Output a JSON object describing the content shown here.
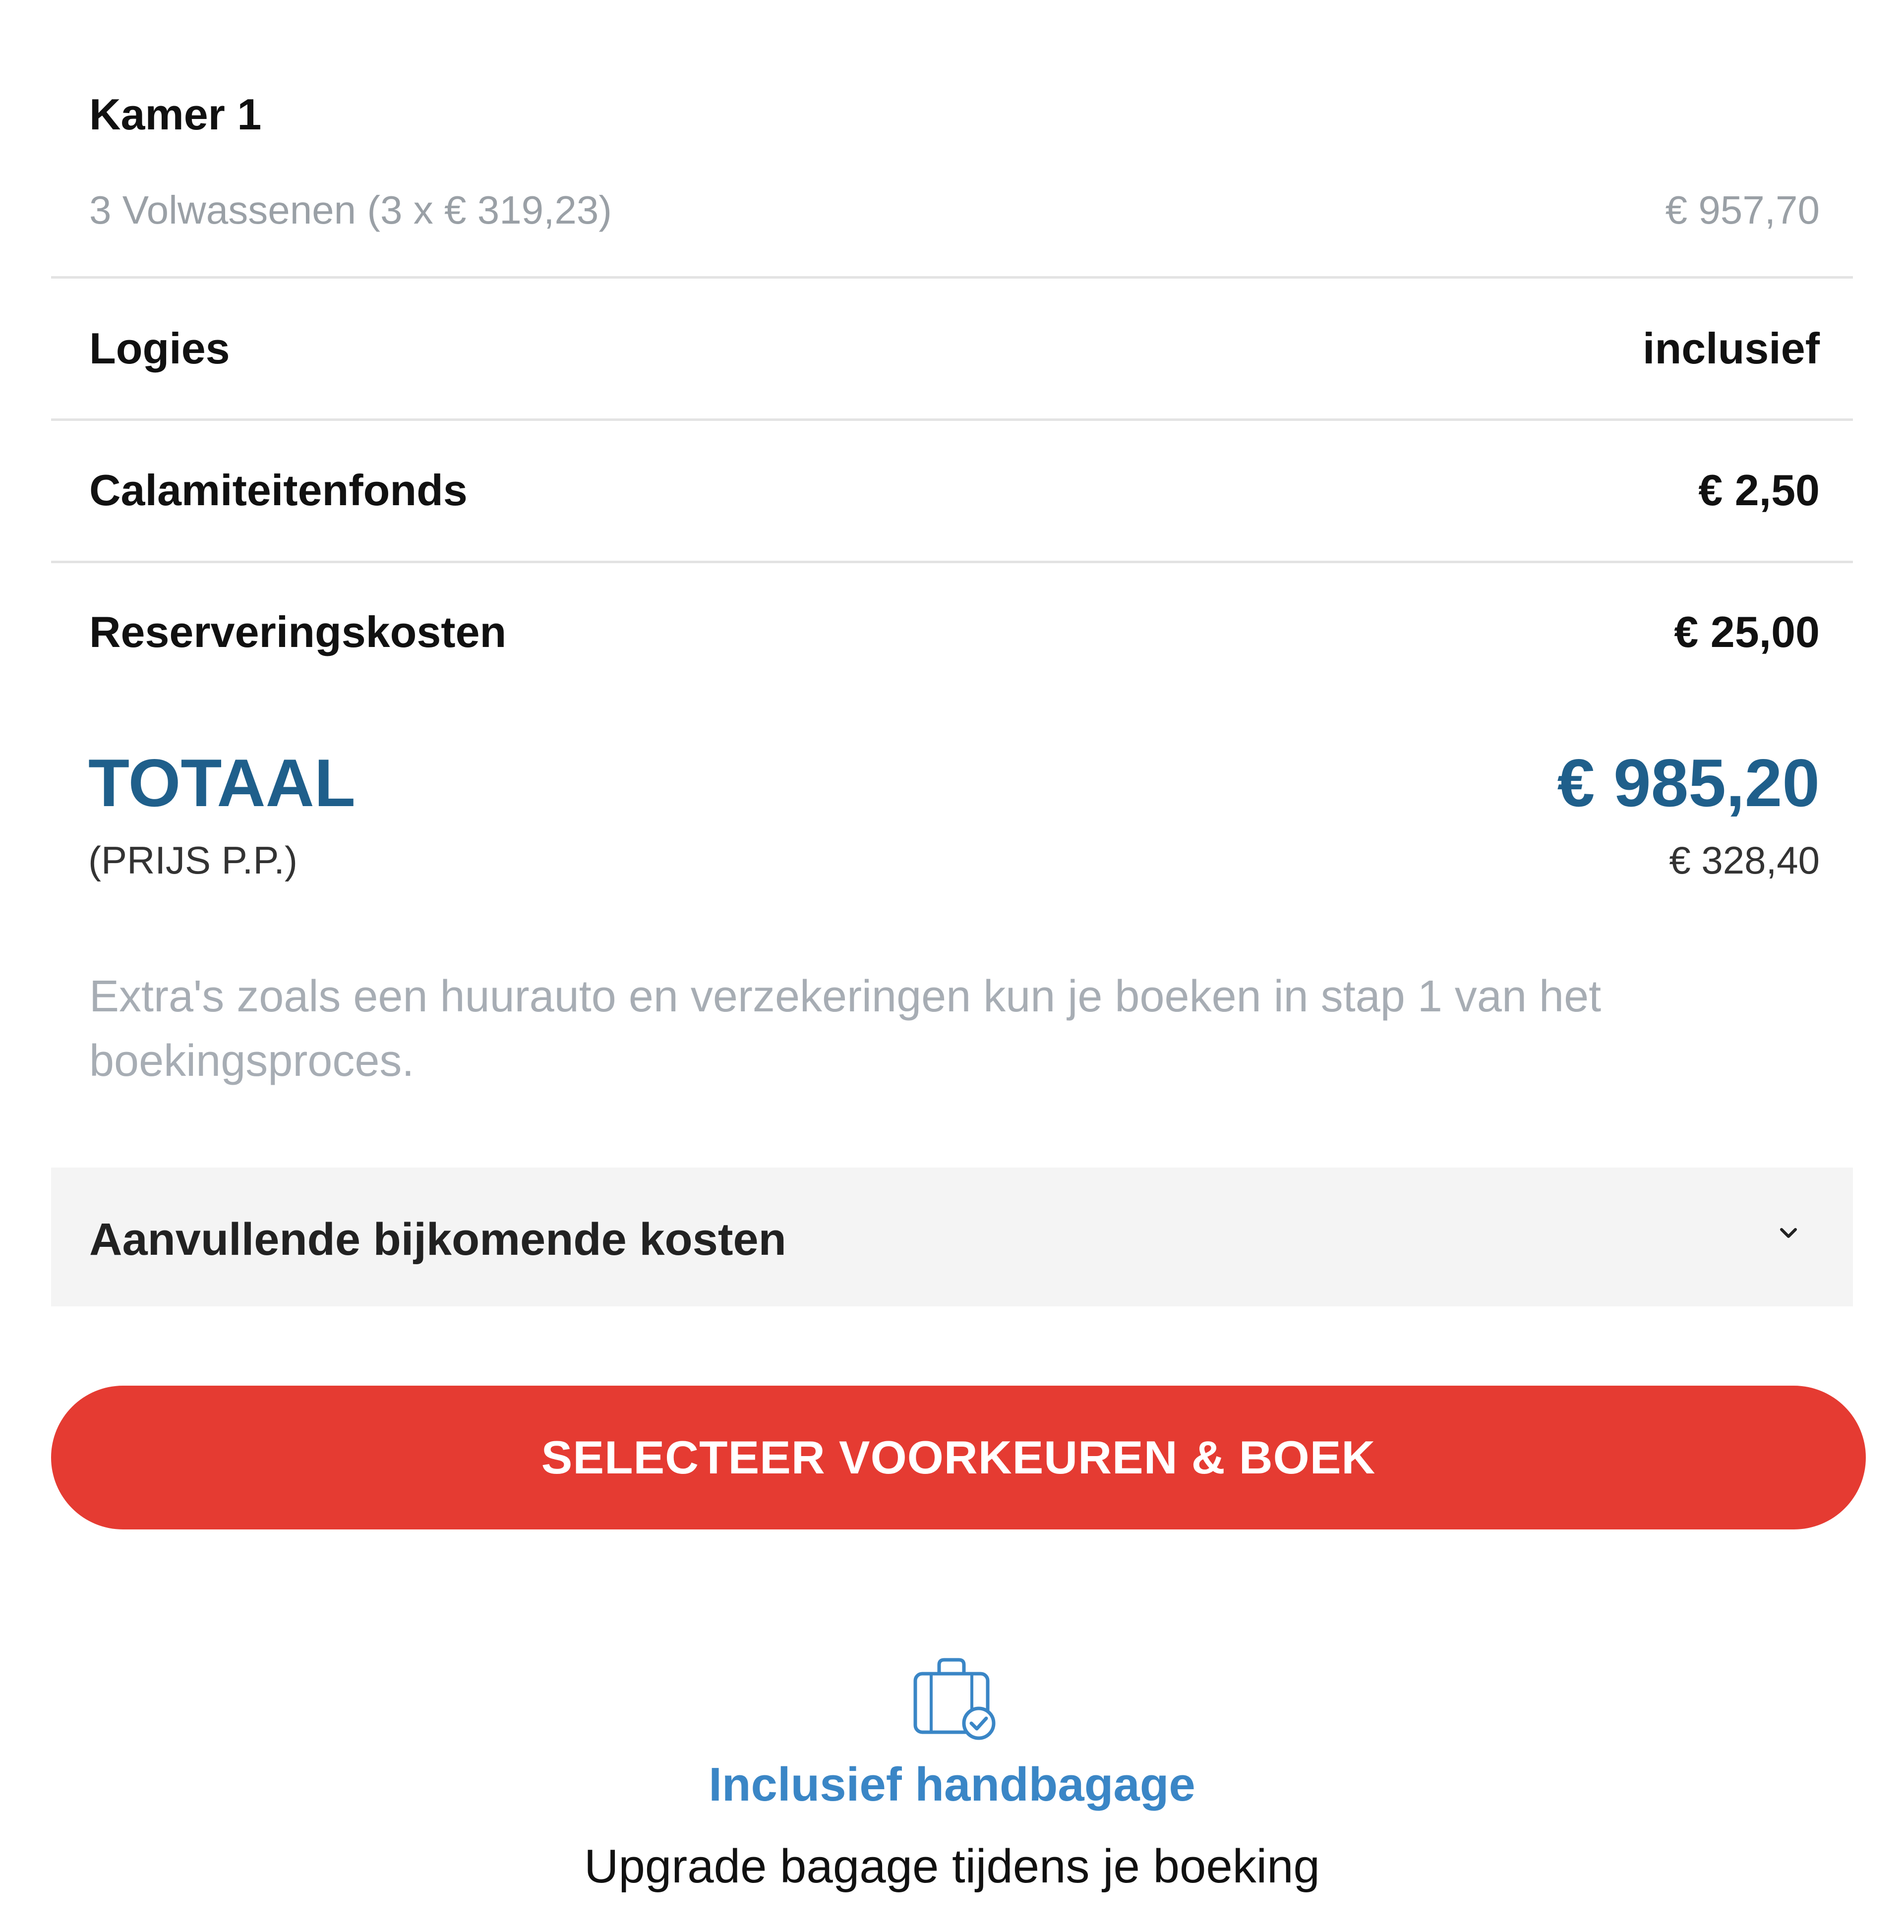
{
  "room": {
    "title": "Kamer 1",
    "occupancy_label": "3 Volwassenen (3 x € 319,23)",
    "occupancy_value": "€ 957,70"
  },
  "rows": [
    {
      "label": "Logies",
      "value": "inclusief"
    },
    {
      "label": "Calamiteitenfonds",
      "value": "€ 2,50"
    },
    {
      "label": "Reserveringskosten",
      "value": "€ 25,00"
    }
  ],
  "total": {
    "label": "TOTAAL",
    "sub_label": "(PRIJS P.P.)",
    "value": "€ 985,20",
    "per_person": "€ 328,40"
  },
  "info": {
    "text": "Extra's zoals een huurauto en verzekeringen kun je boeken in stap 1 van het boekingsproces."
  },
  "extra_costs": {
    "label": "Aanvullende bijkomende kosten",
    "icon": "chevron-down-icon"
  },
  "cta": {
    "label": "SELECTEER VOORKEUREN & BOEK"
  },
  "baggage": {
    "icon": "suitcase-check-icon",
    "title": "Inclusief handbagage",
    "subtitle": "Upgrade bagage tijdens je boeking"
  },
  "colors": {
    "accent_blue": "#1f5f8b",
    "link_blue": "#3a86c6",
    "cta_red": "#e53b32",
    "muted_text": "#9aa0a6",
    "panel_gray": "#f4f4f4"
  }
}
